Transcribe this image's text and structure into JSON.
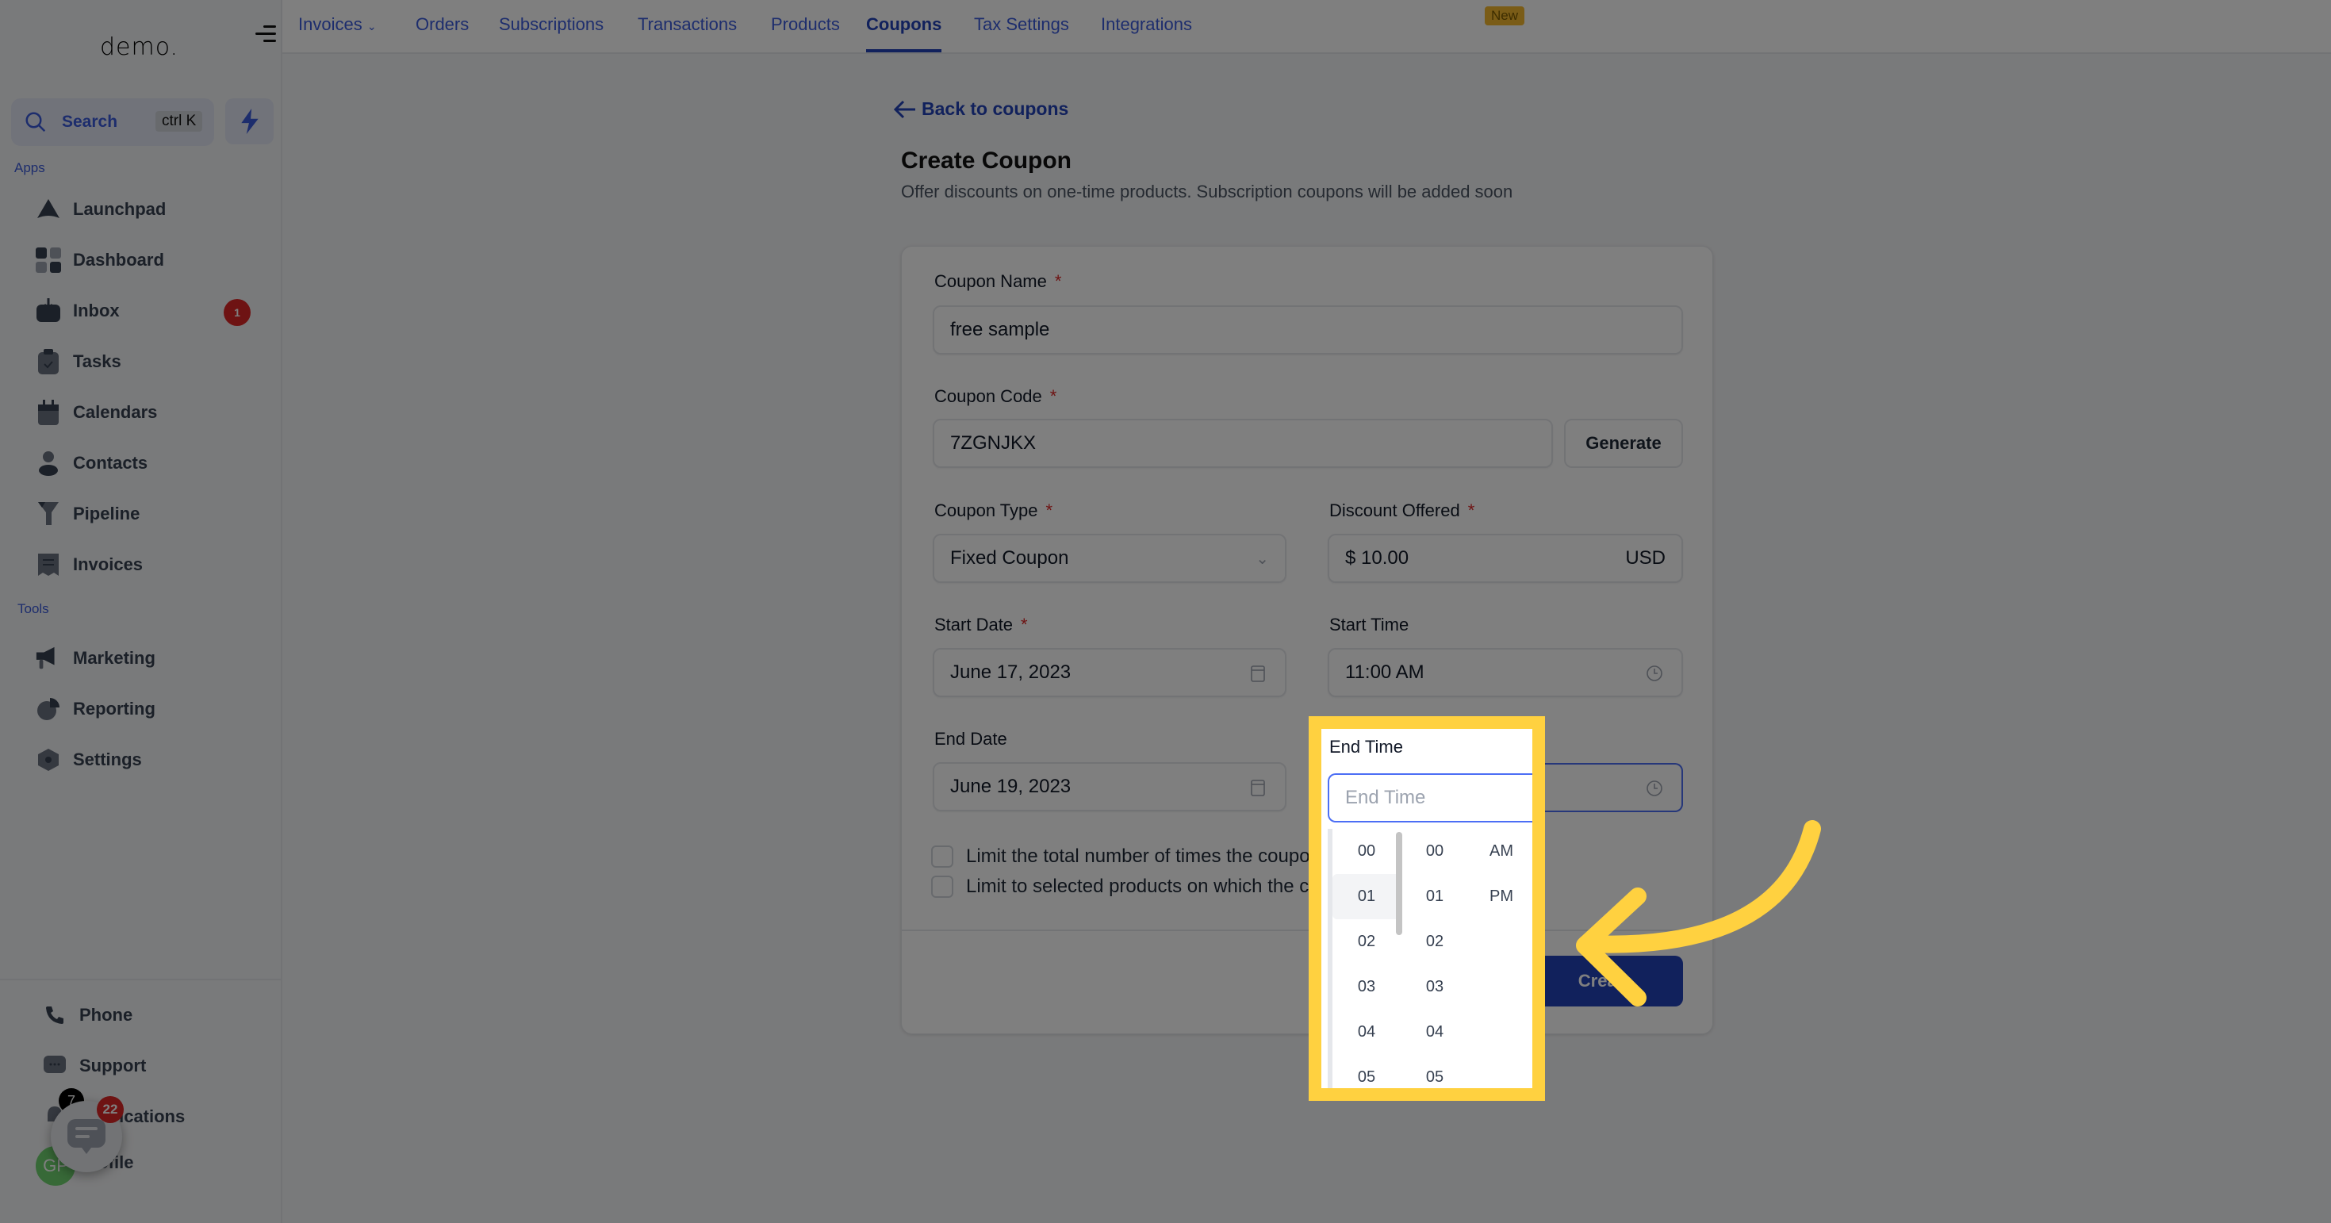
{
  "sidebar": {
    "logo": "demo.",
    "search": {
      "label": "Search",
      "shortcut": "ctrl K"
    },
    "apps_label": "Apps",
    "tools_label": "Tools",
    "apps": [
      {
        "label": "Launchpad",
        "icon": "rocket-icon"
      },
      {
        "label": "Dashboard",
        "icon": "grid-icon"
      },
      {
        "label": "Inbox",
        "icon": "inbox-icon",
        "badge": "1"
      },
      {
        "label": "Tasks",
        "icon": "clipboard-check-icon"
      },
      {
        "label": "Calendars",
        "icon": "calendar-icon"
      },
      {
        "label": "Contacts",
        "icon": "user-icon"
      },
      {
        "label": "Pipeline",
        "icon": "funnel-icon"
      },
      {
        "label": "Invoices",
        "icon": "receipt-icon"
      }
    ],
    "tools": [
      {
        "label": "Marketing",
        "icon": "megaphone-icon"
      },
      {
        "label": "Reporting",
        "icon": "pie-chart-icon"
      },
      {
        "label": "Settings",
        "icon": "gear-icon"
      }
    ],
    "bottom": [
      {
        "label": "Phone",
        "icon": "phone-icon"
      },
      {
        "label": "Support",
        "icon": "chat-icon"
      },
      {
        "label": "Notifications",
        "icon": "bell-icon",
        "badge": "7"
      },
      {
        "label": "Profile",
        "icon": "avatar"
      }
    ],
    "avatar_initials": "GP",
    "chat_widget_badge": "22"
  },
  "topnav": {
    "tabs": [
      {
        "label": "Invoices",
        "has_dropdown": true
      },
      {
        "label": "Orders"
      },
      {
        "label": "Subscriptions"
      },
      {
        "label": "Transactions"
      },
      {
        "label": "Products"
      },
      {
        "label": "Coupons",
        "active": true
      },
      {
        "label": "Tax Settings"
      },
      {
        "label": "Integrations",
        "badge": "New"
      }
    ]
  },
  "main": {
    "back_link": "Back to coupons",
    "title": "Create Coupon",
    "subtitle": "Offer discounts on one-time products. Subscription coupons will be added soon",
    "form": {
      "coupon_name": {
        "label": "Coupon Name",
        "value": "free sample"
      },
      "coupon_code": {
        "label": "Coupon Code",
        "value": "7ZGNJKX",
        "generate_label": "Generate"
      },
      "coupon_type": {
        "label": "Coupon Type",
        "value": "Fixed Coupon"
      },
      "discount": {
        "label": "Discount Offered",
        "value": "$ 10.00",
        "currency": "USD"
      },
      "start_date": {
        "label": "Start Date",
        "value": "June 17, 2023"
      },
      "start_time": {
        "label": "Start Time",
        "value": "11:00 AM"
      },
      "end_date": {
        "label": "End Date",
        "value": "June 19, 2023"
      },
      "end_time": {
        "label": "End Time",
        "placeholder": "End Time"
      },
      "checkbox_limit_total": "Limit the total number of times the coupon",
      "checkbox_limit_products": "Limit to selected products on which the coupon",
      "create_label": "Create"
    },
    "time_picker": {
      "hours": [
        "00",
        "01",
        "02",
        "03",
        "04",
        "05"
      ],
      "minutes": [
        "00",
        "01",
        "02",
        "03",
        "04",
        "05"
      ],
      "meridiem": [
        "AM",
        "PM"
      ],
      "highlighted_hour": "01"
    }
  },
  "annotation": {
    "highlight_color": "#ffd140"
  }
}
